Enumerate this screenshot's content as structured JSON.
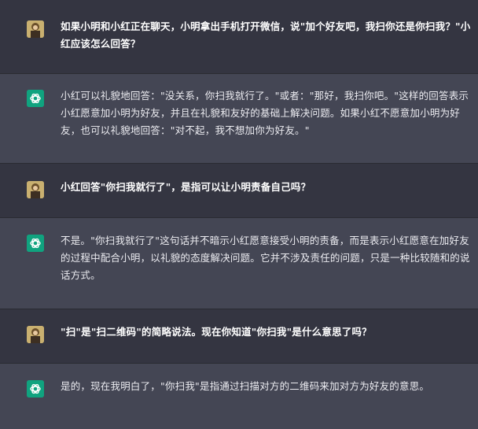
{
  "colors": {
    "background": "#343541",
    "assistant_background": "#444654",
    "text": "#ececf1",
    "assistant_icon": "#10a37f"
  },
  "messages": [
    {
      "role": "user",
      "avatar_icon": "user-avatar-icon",
      "text": "如果小明和小红正在聊天，小明拿出手机打开微信，说\"加个好友吧，我扫你还是你扫我？\"小红应该怎么回答？"
    },
    {
      "role": "assistant",
      "avatar_icon": "chatgpt-logo-icon",
      "text": "小红可以礼貌地回答：\"没关系，你扫我就行了。\"或者：\"那好，我扫你吧。\"这样的回答表示小红愿意加小明为好友，并且在礼貌和友好的基础上解决问题。如果小红不愿意加小明为好友，也可以礼貌地回答：\"对不起，我不想加你为好友。\""
    },
    {
      "role": "user",
      "avatar_icon": "user-avatar-icon",
      "text": "小红回答\"你扫我就行了\"，是指可以让小明责备自己吗？"
    },
    {
      "role": "assistant",
      "avatar_icon": "chatgpt-logo-icon",
      "text": "不是。\"你扫我就行了\"这句话并不暗示小红愿意接受小明的责备，而是表示小红愿意在加好友的过程中配合小明，以礼貌的态度解决问题。它并不涉及责任的问题，只是一种比较随和的说话方式。"
    },
    {
      "role": "user",
      "avatar_icon": "user-avatar-icon",
      "text": "\"扫\"是\"扫二维码\"的简略说法。现在你知道\"你扫我\"是什么意思了吗？"
    },
    {
      "role": "assistant",
      "avatar_icon": "chatgpt-logo-icon",
      "text": "是的，现在我明白了，\"你扫我\"是指通过扫描对方的二维码来加对方为好友的意思。"
    }
  ]
}
